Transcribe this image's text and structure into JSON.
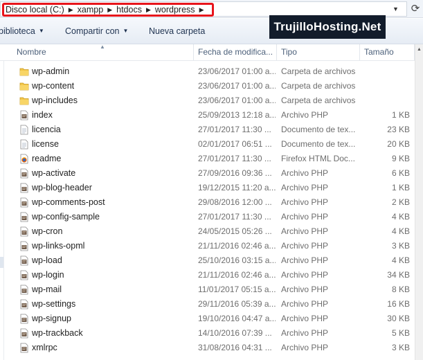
{
  "address": {
    "crumbs": [
      "Disco local (C:)",
      "xampp",
      "htdocs",
      "wordpress"
    ],
    "separator_icon": "chevron-right-icon"
  },
  "toolbar": {
    "organize_label": "biblioteca",
    "share_label": "Compartir con",
    "new_folder_label": "Nueva carpeta"
  },
  "watermark": "TrujilloHosting.Net",
  "columns": {
    "name": "Nombre",
    "date": "Fecha de modifica...",
    "type": "Tipo",
    "size": "Tamaño"
  },
  "files": [
    {
      "name": "wp-admin",
      "date": "23/06/2017 01:00 a...",
      "type": "Carpeta de archivos",
      "size": "",
      "icon": "folder-icon"
    },
    {
      "name": "wp-content",
      "date": "23/06/2017 01:00 a...",
      "type": "Carpeta de archivos",
      "size": "",
      "icon": "folder-icon"
    },
    {
      "name": "wp-includes",
      "date": "23/06/2017 01:00 a...",
      "type": "Carpeta de archivos",
      "size": "",
      "icon": "folder-icon"
    },
    {
      "name": "index",
      "date": "25/09/2013 12:18 a...",
      "type": "Archivo PHP",
      "size": "1 KB",
      "icon": "php-file-icon"
    },
    {
      "name": "licencia",
      "date": "27/01/2017 11:30 ...",
      "type": "Documento de tex...",
      "size": "23 KB",
      "icon": "text-file-icon"
    },
    {
      "name": "license",
      "date": "02/01/2017 06:51 ...",
      "type": "Documento de tex...",
      "size": "20 KB",
      "icon": "text-file-icon"
    },
    {
      "name": "readme",
      "date": "27/01/2017 11:30 ...",
      "type": "Firefox HTML Doc...",
      "size": "9 KB",
      "icon": "firefox-html-icon"
    },
    {
      "name": "wp-activate",
      "date": "27/09/2016 09:36 ...",
      "type": "Archivo PHP",
      "size": "6 KB",
      "icon": "php-file-icon"
    },
    {
      "name": "wp-blog-header",
      "date": "19/12/2015 11:20 a...",
      "type": "Archivo PHP",
      "size": "1 KB",
      "icon": "php-file-icon"
    },
    {
      "name": "wp-comments-post",
      "date": "29/08/2016 12:00 ...",
      "type": "Archivo PHP",
      "size": "2 KB",
      "icon": "php-file-icon"
    },
    {
      "name": "wp-config-sample",
      "date": "27/01/2017 11:30 ...",
      "type": "Archivo PHP",
      "size": "4 KB",
      "icon": "php-file-icon"
    },
    {
      "name": "wp-cron",
      "date": "24/05/2015 05:26 ...",
      "type": "Archivo PHP",
      "size": "4 KB",
      "icon": "php-file-icon"
    },
    {
      "name": "wp-links-opml",
      "date": "21/11/2016 02:46 a...",
      "type": "Archivo PHP",
      "size": "3 KB",
      "icon": "php-file-icon"
    },
    {
      "name": "wp-load",
      "date": "25/10/2016 03:15 a...",
      "type": "Archivo PHP",
      "size": "4 KB",
      "icon": "php-file-icon"
    },
    {
      "name": "wp-login",
      "date": "21/11/2016 02:46 a...",
      "type": "Archivo PHP",
      "size": "34 KB",
      "icon": "php-file-icon"
    },
    {
      "name": "wp-mail",
      "date": "11/01/2017 05:15 a...",
      "type": "Archivo PHP",
      "size": "8 KB",
      "icon": "php-file-icon"
    },
    {
      "name": "wp-settings",
      "date": "29/11/2016 05:39 a...",
      "type": "Archivo PHP",
      "size": "16 KB",
      "icon": "php-file-icon"
    },
    {
      "name": "wp-signup",
      "date": "19/10/2016 04:47 a...",
      "type": "Archivo PHP",
      "size": "30 KB",
      "icon": "php-file-icon"
    },
    {
      "name": "wp-trackback",
      "date": "14/10/2016 07:39 ...",
      "type": "Archivo PHP",
      "size": "5 KB",
      "icon": "php-file-icon"
    },
    {
      "name": "xmlrpc",
      "date": "31/08/2016 04:31 ...",
      "type": "Archivo PHP",
      "size": "3 KB",
      "icon": "php-file-icon"
    }
  ],
  "colors": {
    "highlight_border": "#e8141b",
    "watermark_bg": "#121c2b",
    "header_text": "#4c607a",
    "detail_text": "#6d6d6d"
  }
}
